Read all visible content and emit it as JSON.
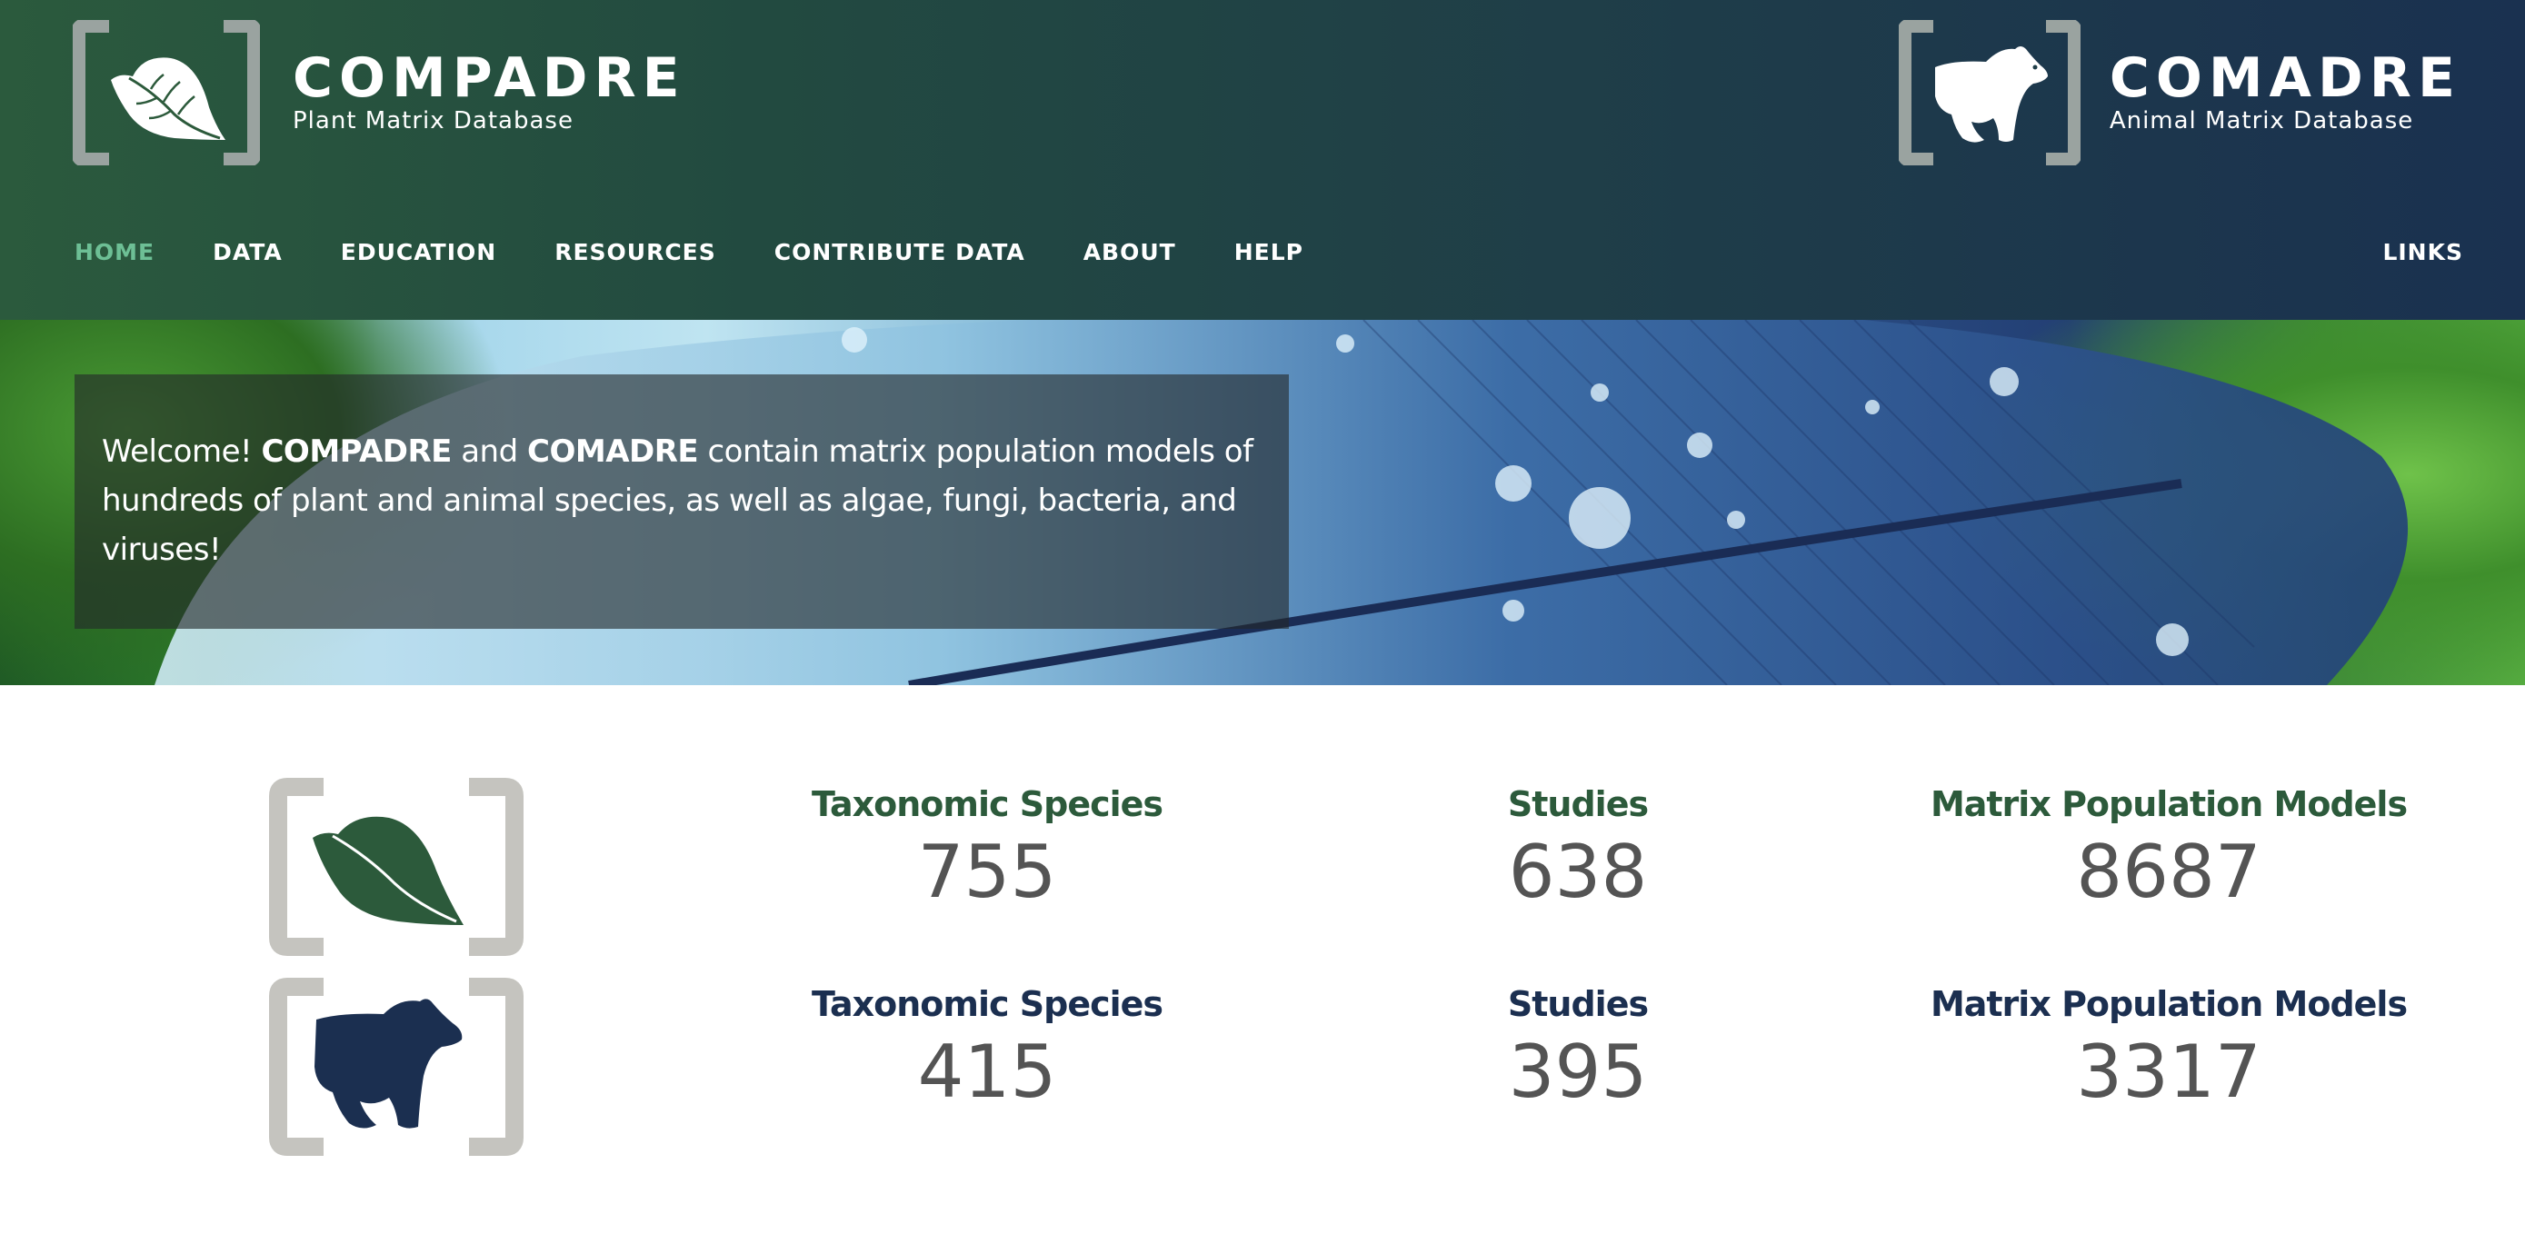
{
  "header": {
    "compadre": {
      "title": "COMPADRE",
      "subtitle": "Plant Matrix Database",
      "icon": "leaf-icon"
    },
    "comadre": {
      "title": "COMADRE",
      "subtitle": "Animal Matrix Database",
      "icon": "bear-icon"
    },
    "colors": {
      "gradient_start": "#2b5a3d",
      "gradient_end": "#1a3150",
      "active_nav": "#6dbf95"
    }
  },
  "nav": {
    "items": [
      {
        "label": "HOME",
        "active": true
      },
      {
        "label": "DATA",
        "active": false
      },
      {
        "label": "EDUCATION",
        "active": false
      },
      {
        "label": "RESOURCES",
        "active": false
      },
      {
        "label": "CONTRIBUTE DATA",
        "active": false
      },
      {
        "label": "ABOUT",
        "active": false
      },
      {
        "label": "HELP",
        "active": false
      }
    ],
    "links_label": "LINKS"
  },
  "hero": {
    "welcome_prefix": "Welcome! ",
    "brand1": "COMPADRE",
    "connector": " and ",
    "brand2": "COMADRE",
    "welcome_suffix": " contain matrix population models of hundreds of plant and animal species, as well as algae, fungi, bacteria, and viruses!"
  },
  "stats": {
    "compadre": {
      "icon": "leaf-icon",
      "color": "#2c5a3b",
      "species_label": "Taxonomic Species",
      "species_value": "755",
      "studies_label": "Studies",
      "studies_value": "638",
      "models_label": "Matrix Population Models",
      "models_value": "8687"
    },
    "comadre": {
      "icon": "bear-icon",
      "color": "#1b2f50",
      "species_label": "Taxonomic Species",
      "species_value": "415",
      "studies_label": "Studies",
      "studies_value": "395",
      "models_label": "Matrix Population Models",
      "models_value": "3317"
    }
  }
}
